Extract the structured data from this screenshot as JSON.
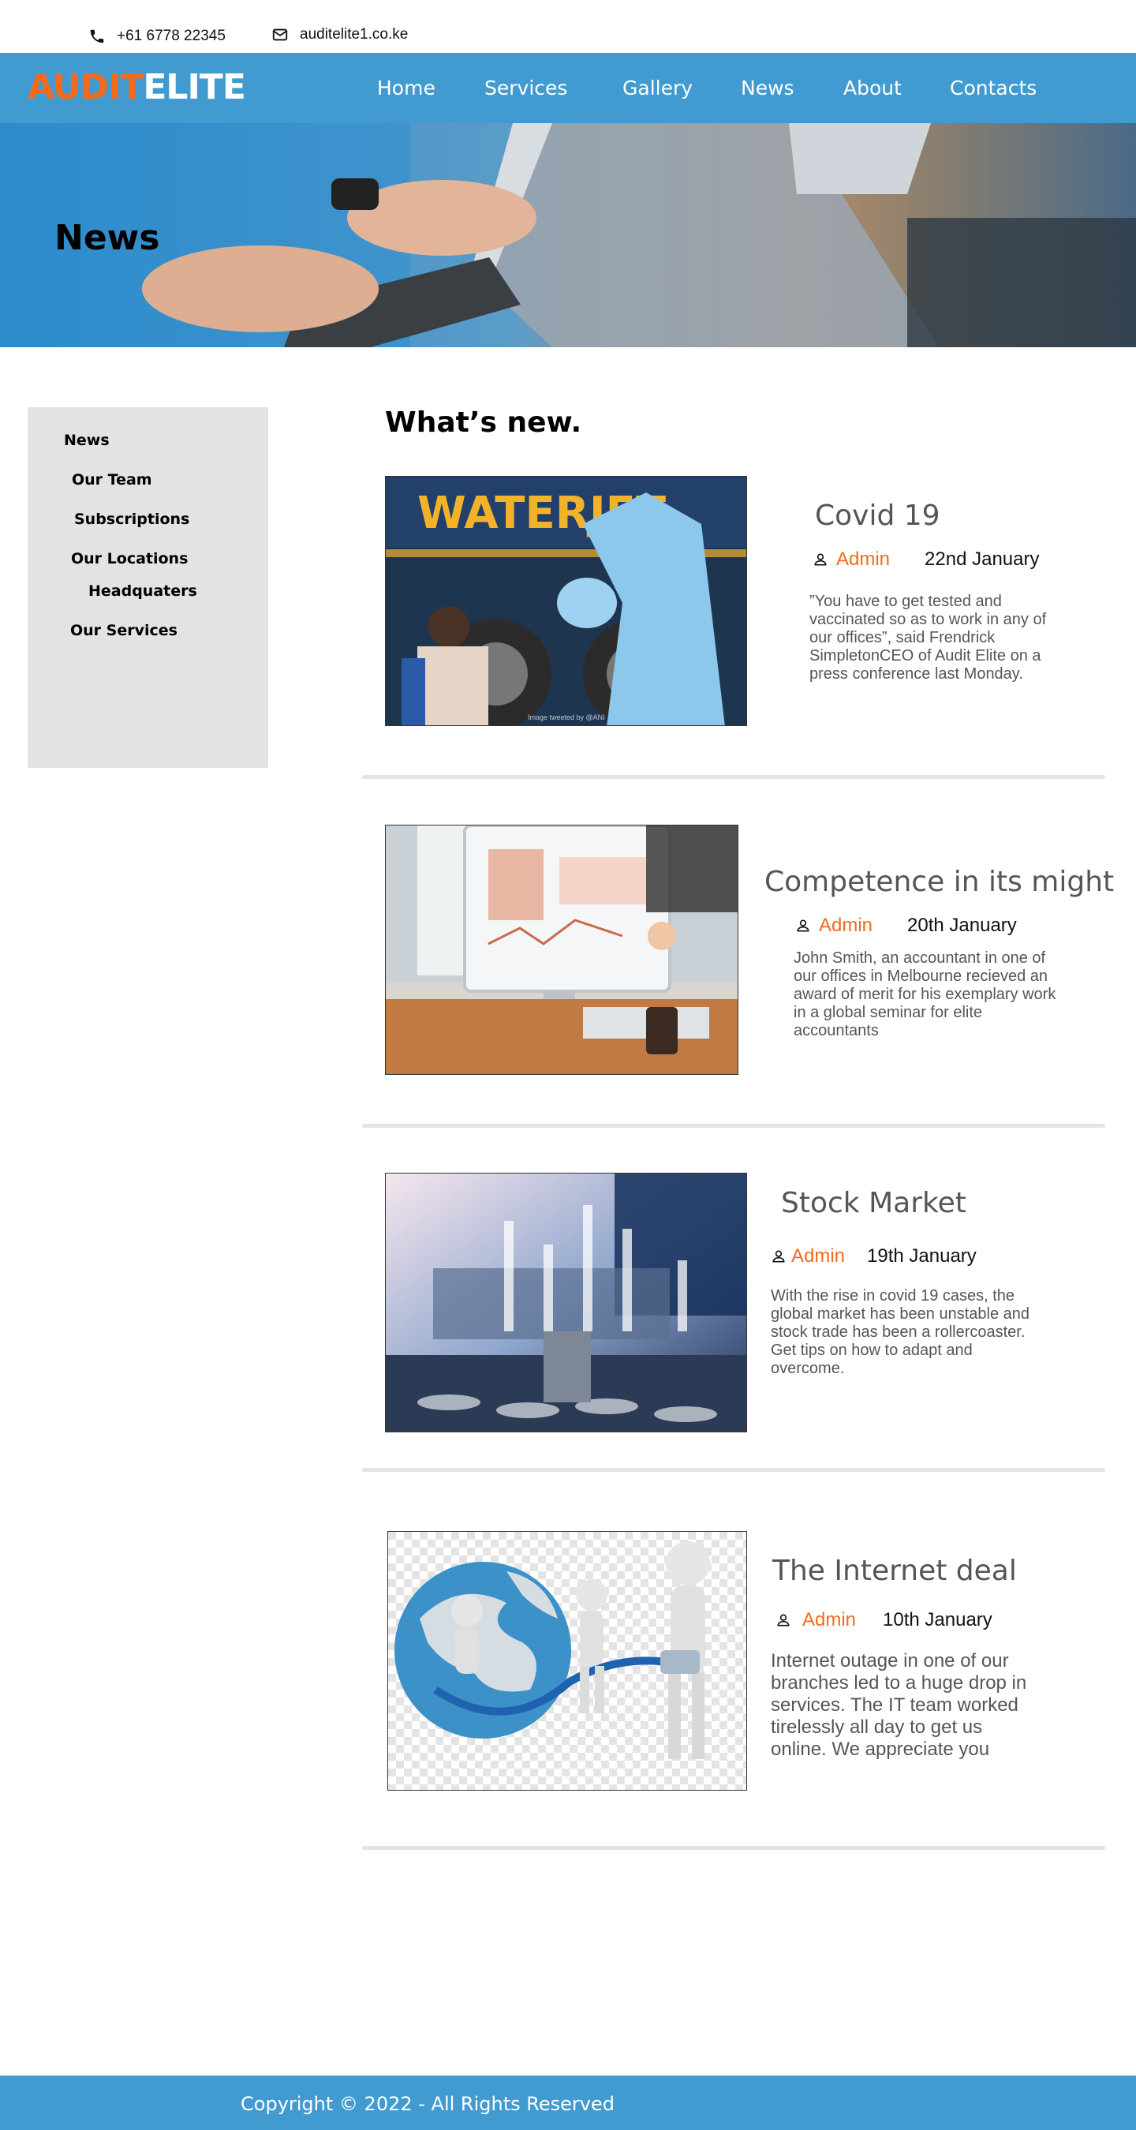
{
  "contact": {
    "phone": "+61 6778 22345",
    "email": "auditelite1.co.ke"
  },
  "brand": {
    "part1": "AUDIT",
    "part2": "ELITE",
    "color_accent": "#f26b1d",
    "color_primary": "#419bd0"
  },
  "nav": {
    "items": [
      "Home",
      "Services",
      "Gallery",
      "News",
      "About",
      "Contacts"
    ]
  },
  "hero": {
    "title": "News"
  },
  "sidebar": {
    "links": [
      "News",
      "Our Team",
      "Subscriptions",
      "Our Locations",
      "Headquaters",
      "Our Services"
    ]
  },
  "main": {
    "heading": "What’s new."
  },
  "posts": [
    {
      "title": "Covid 19",
      "author": "Admin",
      "date": "22nd January",
      "excerpt": "”You have to get tested and vaccinated so as to work in any of our offices”, said Frendrick SimpletonCEO of Audit Elite on a press conference last Monday.",
      "image_caption": "Image tweeted by @ANI"
    },
    {
      "title": "Competence in its might",
      "author": "Admin",
      "date": "20th January",
      "excerpt": "John Smith, an accountant in one of our offices in Melbourne recieved an award of merit for his exemplary work in a global seminar for elite accountants"
    },
    {
      "title": "Stock Market",
      "author": "Admin",
      "date": "19th January",
      "excerpt": "With the rise in covid 19 cases, the global market has been unstable and stock trade has been a rollercoaster. Get tips on how to adapt and overcome."
    },
    {
      "title": "The Internet deal",
      "author": "Admin",
      "date": "10th January",
      "excerpt": "Internet outage in one of our branches led to a huge drop in services. The IT team worked tirelessly all day to get us online. We appreciate you"
    }
  ],
  "footer": {
    "text": "Copyright © 2022 - All Rights Reserved"
  }
}
